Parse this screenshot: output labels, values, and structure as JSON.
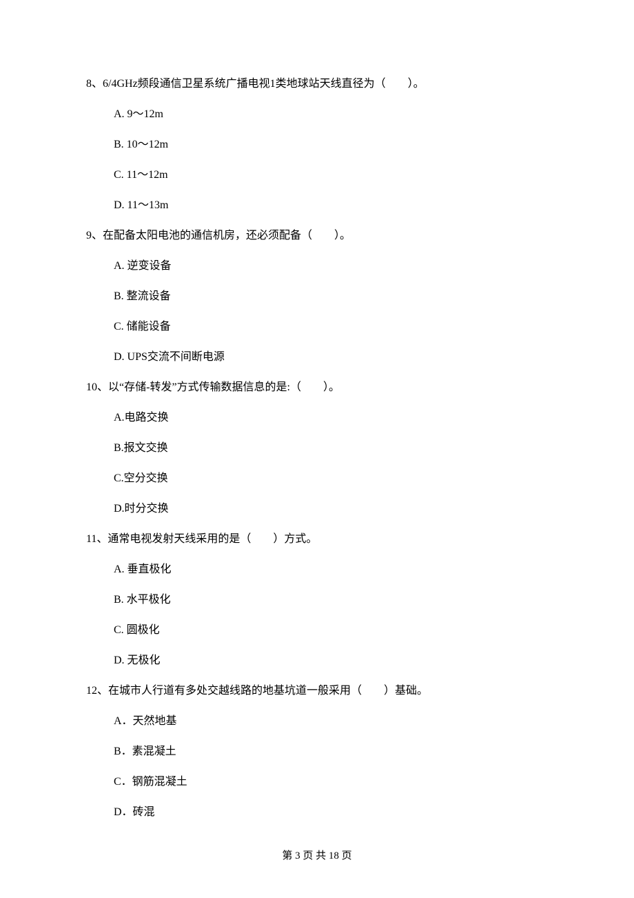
{
  "questions": [
    {
      "num": "8、",
      "text": "6/4GHz频段通信卫星系统广播电视1类地球站天线直径为（　　）。",
      "options": [
        "A. 9～12m",
        "B. 10～12m",
        "C. 11～12m",
        "D. 11～13m"
      ]
    },
    {
      "num": "9、",
      "text": "在配备太阳电池的通信机房，还必须配备（　　）。",
      "options": [
        "A. 逆变设备",
        "B. 整流设备",
        "C. 储能设备",
        "D. UPS交流不间断电源"
      ]
    },
    {
      "num": "10、",
      "text": "以“存储-转发”方式传输数据信息的是:（　　）。",
      "options": [
        "A.电路交换",
        "B.报文交换",
        "C.空分交换",
        "D.时分交换"
      ]
    },
    {
      "num": "11、",
      "text": "通常电视发射天线采用的是（　　）方式。",
      "options": [
        "A. 垂直极化",
        "B. 水平极化",
        "C. 圆极化",
        "D. 无极化"
      ]
    },
    {
      "num": "12、",
      "text": "在城市人行道有多处交越线路的地基坑道一般采用（　　）基础。",
      "options": [
        "A．天然地基",
        "B．素混凝土",
        "C．钢筋混凝土",
        "D．砖混"
      ]
    }
  ],
  "footer": "第 3 页 共 18 页"
}
